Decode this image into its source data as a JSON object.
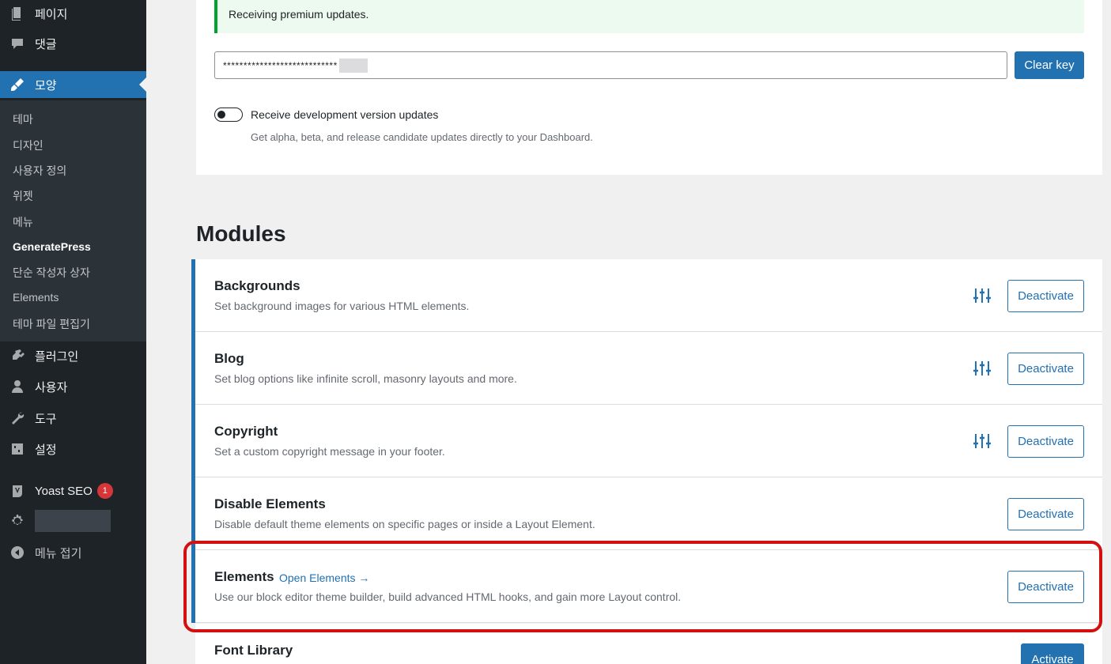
{
  "sidebar": {
    "top_items": [
      {
        "label": "페이지",
        "icon": "pages-icon"
      },
      {
        "label": "댓글",
        "icon": "comments-icon"
      },
      {
        "label": "모양",
        "icon": "appearance-icon"
      }
    ],
    "submenu": [
      "테마",
      "디자인",
      "사용자 정의",
      "위젯",
      "메뉴",
      "GeneratePress",
      "단순 작성자 상자",
      "Elements",
      "테마 파일 편집기"
    ],
    "bottom_items": [
      {
        "label": "플러그인",
        "icon": "plugins-icon"
      },
      {
        "label": "사용자",
        "icon": "users-icon"
      },
      {
        "label": "도구",
        "icon": "tools-icon"
      },
      {
        "label": "설정",
        "icon": "settings-icon"
      }
    ],
    "yoast": {
      "label": "Yoast SEO",
      "badge": "1"
    },
    "collapse": "메뉴 접기"
  },
  "license": {
    "notice": "Receiving premium updates.",
    "key_value": "****************************",
    "clear_label": "Clear key",
    "dev_toggle_label": "Receive development version updates",
    "dev_toggle_desc": "Get alpha, beta, and release candidate updates directly to your Dashboard."
  },
  "modules": {
    "title": "Modules",
    "items": [
      {
        "name": "Backgrounds",
        "desc": "Set background images for various HTML elements.",
        "action": "Deactivate"
      },
      {
        "name": "Blog",
        "desc": "Set blog options like infinite scroll, masonry layouts and more.",
        "action": "Deactivate"
      },
      {
        "name": "Copyright",
        "desc": "Set a custom copyright message in your footer.",
        "action": "Deactivate"
      },
      {
        "name": "Disable Elements",
        "desc": "Disable default theme elements on specific pages or inside a Layout Element.",
        "action": "Deactivate"
      },
      {
        "name": "Elements",
        "link": "Open Elements →",
        "desc": "Use our block editor theme builder, build advanced HTML hooks, and gain more Layout control.",
        "action": "Deactivate"
      },
      {
        "name": "Font Library",
        "action": "Activate"
      }
    ]
  },
  "colors": {
    "accent": "#2271b1",
    "sidebar_bg": "#1d2327",
    "highlight": "#d40f0f",
    "notice_bg": "#edfaef"
  }
}
